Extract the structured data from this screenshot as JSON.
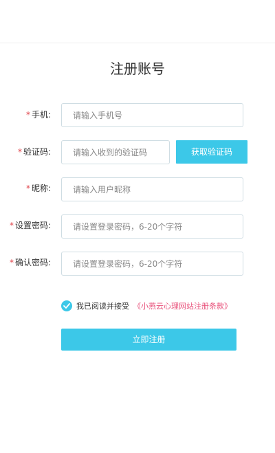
{
  "page": {
    "title": "注册账号"
  },
  "form": {
    "required_mark": "*",
    "phone": {
      "label": "手机:",
      "placeholder": "请输入手机号"
    },
    "code": {
      "label": "验证码:",
      "placeholder": "请输入收到的验证码",
      "button": "获取验证码"
    },
    "nickname": {
      "label": "昵称:",
      "placeholder": "请输入用户昵称"
    },
    "password": {
      "label": "设置密码:",
      "placeholder": "请设置登录密码，6-20个字符"
    },
    "confirm": {
      "label": "确认密码:",
      "placeholder": "请设置登录密码，6-20个字符"
    },
    "agreement": {
      "text": "我已阅读并接受",
      "link": "《小燕云心理网站注册条款》",
      "checked": true
    },
    "submit": "立即注册"
  },
  "colors": {
    "accent": "#3cc8e8",
    "required": "#e0434a",
    "link": "#e8507a"
  }
}
